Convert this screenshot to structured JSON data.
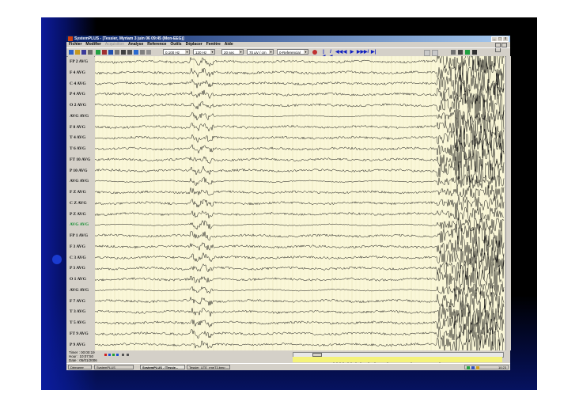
{
  "window": {
    "title": "SystemPLUS - [Tessier, Myriam 3 juin 06 09:45 (Mon-EEG)]",
    "control_min": "_",
    "control_max": "□",
    "control_close": "x"
  },
  "menu": {
    "items": [
      "Fichier",
      "Modifier",
      "Acquisition",
      "Analyse",
      "Reference",
      "Outils",
      "Déplacer",
      "Fenêtre",
      "Aide"
    ],
    "disabled": [
      false,
      false,
      true,
      false,
      false,
      false,
      false,
      false,
      false
    ]
  },
  "toolbar": {
    "filter_value": "0,100 Hz",
    "highpass_value": "120 Hz",
    "time_scale": "20 sec",
    "amplitude": "70 µV / cm",
    "montage": "0-Referencial",
    "nav_buttons": [
      "|◀",
      "/◀",
      "◀◀",
      "◀",
      "▶",
      "▶▶",
      "▶/",
      "▶|"
    ]
  },
  "channels": [
    {
      "label": "FP 2 AVG",
      "color": "#111111"
    },
    {
      "label": "F 4 AVG",
      "color": "#111111"
    },
    {
      "label": "C 4 AVG",
      "color": "#111111"
    },
    {
      "label": "P 4 AVG",
      "color": "#111111"
    },
    {
      "label": "O 2 AVG",
      "color": "#111111"
    },
    {
      "label": "AVG AVG",
      "color": "#111111"
    },
    {
      "label": "F 8 AVG",
      "color": "#111111"
    },
    {
      "label": "T 4 AVG",
      "color": "#111111"
    },
    {
      "label": "T 6 AVG",
      "color": "#111111"
    },
    {
      "label": "FT 10 AVG",
      "color": "#111111"
    },
    {
      "label": "P 10 AVG",
      "color": "#111111"
    },
    {
      "label": "AVG AVG",
      "color": "#111111"
    },
    {
      "label": "F Z AVG",
      "color": "#111111"
    },
    {
      "label": "C Z AVG",
      "color": "#111111"
    },
    {
      "label": "P Z AVG",
      "color": "#111111"
    },
    {
      "label": "AVG AVG",
      "color": "#0a8a2a"
    },
    {
      "label": "FP 1 AVG",
      "color": "#111111"
    },
    {
      "label": "F 3 AVG",
      "color": "#111111"
    },
    {
      "label": "C 3 AVG",
      "color": "#111111"
    },
    {
      "label": "P 3 AVG",
      "color": "#111111"
    },
    {
      "label": "O 1 AVG",
      "color": "#111111"
    },
    {
      "label": "AVG AVG",
      "color": "#111111"
    },
    {
      "label": "F 7 AVG",
      "color": "#111111"
    },
    {
      "label": "T 3 AVG",
      "color": "#111111"
    },
    {
      "label": "T 5 AVG",
      "color": "#111111"
    },
    {
      "label": "FT 9 AVG",
      "color": "#111111"
    },
    {
      "label": "P 9 AVG",
      "color": "#111111"
    }
  ],
  "status": {
    "timer": "Timer : 00:00:19",
    "hour": "Hour : 10:07:50",
    "date": "Date : 05/01/2006"
  },
  "taskbar": {
    "start": "Démarrer",
    "tasks": [
      "SystemPLUS",
      "SystemPLUS - [Tessie...",
      "Tessier_UTE_rmeT3.bmp ..."
    ],
    "clock": "10:23"
  },
  "colors": {
    "trace_background": "#faf7d8",
    "trace_line": "#111111",
    "title_bar_start": "#0a246a",
    "timeline": "#f4f27a",
    "slide_background": "#000000"
  }
}
